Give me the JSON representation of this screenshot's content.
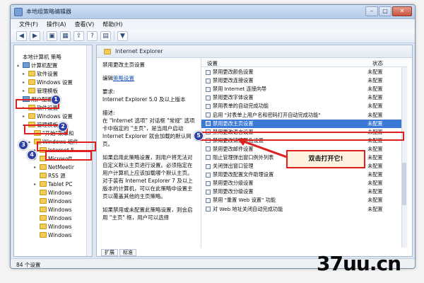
{
  "window": {
    "title": "本地组策略编辑器",
    "controls": {
      "minimize": "–",
      "maximize": "□",
      "close": "✕"
    }
  },
  "menu": [
    "文件(F)",
    "操作(A)",
    "查看(V)",
    "帮助(H)"
  ],
  "toolbar_icons": [
    "back-arrow-icon",
    "forward-arrow-icon",
    "folder-up-icon",
    "view-icon",
    "export-icon",
    "help-icon",
    "properties-icon",
    "filter-icon"
  ],
  "tree": [
    {
      "label": "本地计算机 策略",
      "indent": 0,
      "icon": "none",
      "exp": ""
    },
    {
      "label": "计算机配置",
      "indent": 0,
      "icon": "comp",
      "exp": "▴"
    },
    {
      "label": "软件设置",
      "indent": 1,
      "icon": "folder",
      "exp": "▸"
    },
    {
      "label": "Windows 设置",
      "indent": 1,
      "icon": "folder",
      "exp": "▸"
    },
    {
      "label": "管理模板",
      "indent": 1,
      "icon": "folder",
      "exp": "▸"
    },
    {
      "label": "用户配置",
      "indent": 0,
      "icon": "comp",
      "exp": "▴"
    },
    {
      "label": "软件设置",
      "indent": 1,
      "icon": "folder",
      "exp": "▸"
    },
    {
      "label": "Windows 设置",
      "indent": 1,
      "icon": "folder",
      "exp": "▸"
    },
    {
      "label": "管理模板",
      "indent": 1,
      "icon": "folder",
      "exp": "▴"
    },
    {
      "label": "\"开始\"菜单和",
      "indent": 2,
      "icon": "folder",
      "exp": ""
    },
    {
      "label": "Windows 组件",
      "indent": 2,
      "icon": "folder",
      "exp": "▴"
    },
    {
      "label": "Internet E",
      "indent": 3,
      "icon": "folder",
      "exp": "▸"
    },
    {
      "label": "Microsoft",
      "indent": 3,
      "icon": "folder",
      "exp": "▸"
    },
    {
      "label": "NetMeetir",
      "indent": 3,
      "icon": "folder",
      "exp": "▸"
    },
    {
      "label": "RSS 源",
      "indent": 3,
      "icon": "folder",
      "exp": ""
    },
    {
      "label": "Tablet PC",
      "indent": 3,
      "icon": "folder",
      "exp": "▸"
    },
    {
      "label": "Windows",
      "indent": 3,
      "icon": "folder",
      "exp": ""
    },
    {
      "label": "Windows",
      "indent": 3,
      "icon": "folder",
      "exp": ""
    },
    {
      "label": "Windows",
      "indent": 3,
      "icon": "folder",
      "exp": ""
    },
    {
      "label": "Windows",
      "indent": 3,
      "icon": "folder",
      "exp": ""
    },
    {
      "label": "Windows",
      "indent": 3,
      "icon": "folder",
      "exp": ""
    },
    {
      "label": "Windows",
      "indent": 3,
      "icon": "folder",
      "exp": ""
    }
  ],
  "right_header": "Internet Explorer",
  "description": {
    "title": "禁用更改主页设置",
    "edit_prefix": "编辑",
    "edit_link": "策略设置",
    "req_label": "要求:",
    "req_text": "Internet Explorer 5.0 及以上版本",
    "desc_label": "描述:",
    "desc_text": "在 \"Internet 选项\" 对话框 \"常规\" 选项卡中指定的 \"主页\"，是当用户启动 Internet Explorer 就会加载的默认网页。",
    "p2": "如果启用此策略设置，则用户将无法对自定义默认主页进行设置。必须指定在用户计算机上应该加载哪个默认主页。对于装有 Internet Explorer 7 及以上版本的计算机，可以在此策略中设置主页以覆盖其他的主页策略。",
    "p3": "如果禁用或未配置此策略设置，则会启用 \"主页\" 框，用户可以选择"
  },
  "list": {
    "col_setting": "设置",
    "col_state": "状态",
    "rows": [
      {
        "name": "禁用更改颜色设置",
        "state": "未配置"
      },
      {
        "name": "禁用更改连接设置",
        "state": "未配置"
      },
      {
        "name": "禁用 Internet 连接向导",
        "state": "未配置"
      },
      {
        "name": "禁用更改字体设置",
        "state": "未配置"
      },
      {
        "name": "禁用表单的自动完成功能",
        "state": "未配置"
      },
      {
        "name": "启用 \"对表单上用户名和密码打开自动完成功能\"",
        "state": "未配置"
      },
      {
        "name": "禁用更改主页设置",
        "state": "未配置"
      },
      {
        "name": "禁用更改语言设置",
        "state": "未配置"
      },
      {
        "name": "禁用更改链接颜色设置",
        "state": "未配置"
      },
      {
        "name": "禁用更改邮件设置",
        "state": "未配置"
      },
      {
        "name": "阻止管理弹出窗口例外列表",
        "state": "未配置"
      },
      {
        "name": "关闭弹出窗口管理",
        "state": "未配置"
      },
      {
        "name": "禁用更改配置文件助理设置",
        "state": "未配置"
      },
      {
        "name": "禁用更改分级设置",
        "state": "未配置"
      },
      {
        "name": "禁用更改分级设置",
        "state": "未配置"
      },
      {
        "name": "禁用 \"重置 Web 设置\" 功能",
        "state": "未配置"
      },
      {
        "name": "对 Web 地址关闭自动完成功能",
        "state": "未配置"
      }
    ],
    "selected_index": 6
  },
  "tabs": [
    "扩展",
    "标准"
  ],
  "status": "84 个设置",
  "annotations": {
    "badges": [
      "1",
      "2",
      "3",
      "4",
      "5"
    ],
    "callout": "双击打开它!"
  },
  "watermark": "37uu.cn",
  "colors": {
    "accent": "#3b79d6",
    "annotation_red": "#e01f1f",
    "badge_blue": "#2d3fa8"
  }
}
